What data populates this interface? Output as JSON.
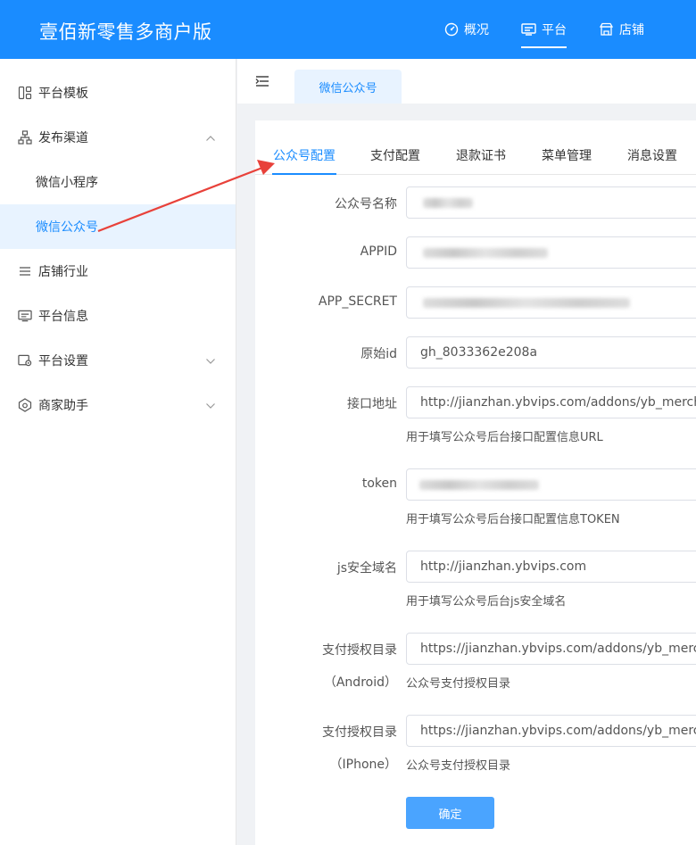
{
  "app": {
    "title": "壹佰新零售多商户版"
  },
  "topnav": [
    {
      "label": "概况",
      "icon": "dashboard-icon"
    },
    {
      "label": "平台",
      "icon": "monitor-icon",
      "active": true
    },
    {
      "label": "店铺",
      "icon": "store-icon"
    }
  ],
  "sidebar": {
    "items": [
      {
        "label": "平台模板",
        "icon": "template-icon"
      },
      {
        "label": "发布渠道",
        "icon": "sitemap-icon",
        "expanded": true,
        "children": [
          "微信小程序",
          "微信公众号"
        ]
      },
      {
        "label": "店铺行业",
        "icon": "list-icon"
      },
      {
        "label": "平台信息",
        "icon": "info-monitor-icon"
      },
      {
        "label": "平台设置",
        "icon": "settings-icon"
      },
      {
        "label": "商家助手",
        "icon": "assistant-icon"
      }
    ]
  },
  "page_tab": "微信公众号",
  "subtabs": [
    "公众号配置",
    "支付配置",
    "退款证书",
    "菜单管理",
    "消息设置"
  ],
  "form": {
    "account_name": {
      "label": "公众号名称"
    },
    "appid": {
      "label": "APPID"
    },
    "app_secret": {
      "label": "APP_SECRET"
    },
    "original_id": {
      "label": "原始id",
      "value": "gh_8033362e208a"
    },
    "api_url": {
      "label": "接口地址",
      "value": "http://jianzhan.ybvips.com/addons/yb_merchant/co",
      "hint": "用于填写公众号后台接口配置信息URL"
    },
    "token": {
      "label": "token",
      "hint": "用于填写公众号后台接口配置信息TOKEN"
    },
    "js_domain": {
      "label": "js安全域名",
      "value": "http://jianzhan.ybvips.com",
      "hint": "用于填写公众号后台js安全域名"
    },
    "pay_dir_android": {
      "label": "支付授权目录",
      "sublabel": "（Android）",
      "value": "https://jianzhan.ybvips.com/addons/yb_merchant/g",
      "hint": "公众号支付授权目录"
    },
    "pay_dir_iphone": {
      "label": "支付授权目录",
      "sublabel": "（IPhone）",
      "value": "https://jianzhan.ybvips.com/addons/yb_merchant/g",
      "hint": "公众号支付授权目录"
    },
    "submit_label": "确定"
  },
  "colors": {
    "primary": "#1a8cff",
    "annotation_arrow": "#e8413a"
  }
}
